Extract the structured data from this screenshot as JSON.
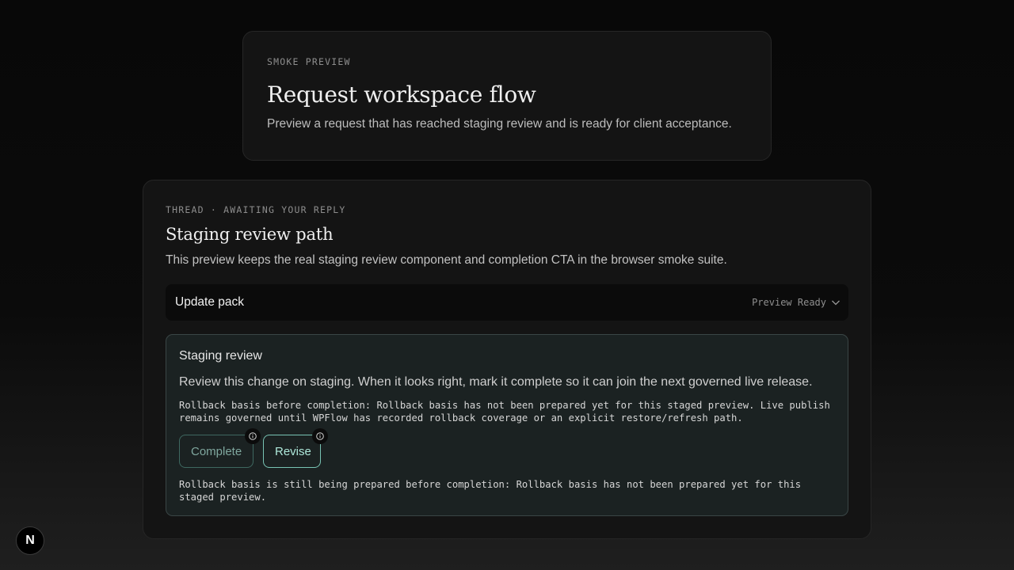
{
  "hero": {
    "eyebrow": "SMOKE PREVIEW",
    "title": "Request workspace flow",
    "subtitle": "Preview a request that has reached staging review and is ready for client acceptance."
  },
  "thread": {
    "eyebrow": "THREAD · AWAITING YOUR REPLY",
    "title": "Staging review path",
    "subtitle": "This preview keeps the real staging review component and completion CTA in the browser smoke suite.",
    "update_pack": {
      "label": "Update pack",
      "status": "Preview Ready",
      "icon": "chevron-down-icon"
    },
    "review": {
      "title": "Staging review",
      "body": "Review this change on staging. When it looks right, mark it complete so it can join the next governed live release.",
      "rollback_note": "Rollback basis before completion: Rollback basis has not been prepared yet for this staged preview. Live publish remains governed until WPFlow has recorded rollback coverage or an explicit restore/refresh path.",
      "complete_label": "Complete",
      "revise_label": "Revise",
      "footer_note": "Rollback basis is still being prepared before completion: Rollback basis has not been prepared yet for this staged preview."
    }
  },
  "badge": {
    "letter": "N"
  },
  "colors": {
    "background": "#0b0b0b",
    "card": "#141414",
    "review_panel": "#1b2222",
    "accent": "#78c4b4"
  }
}
